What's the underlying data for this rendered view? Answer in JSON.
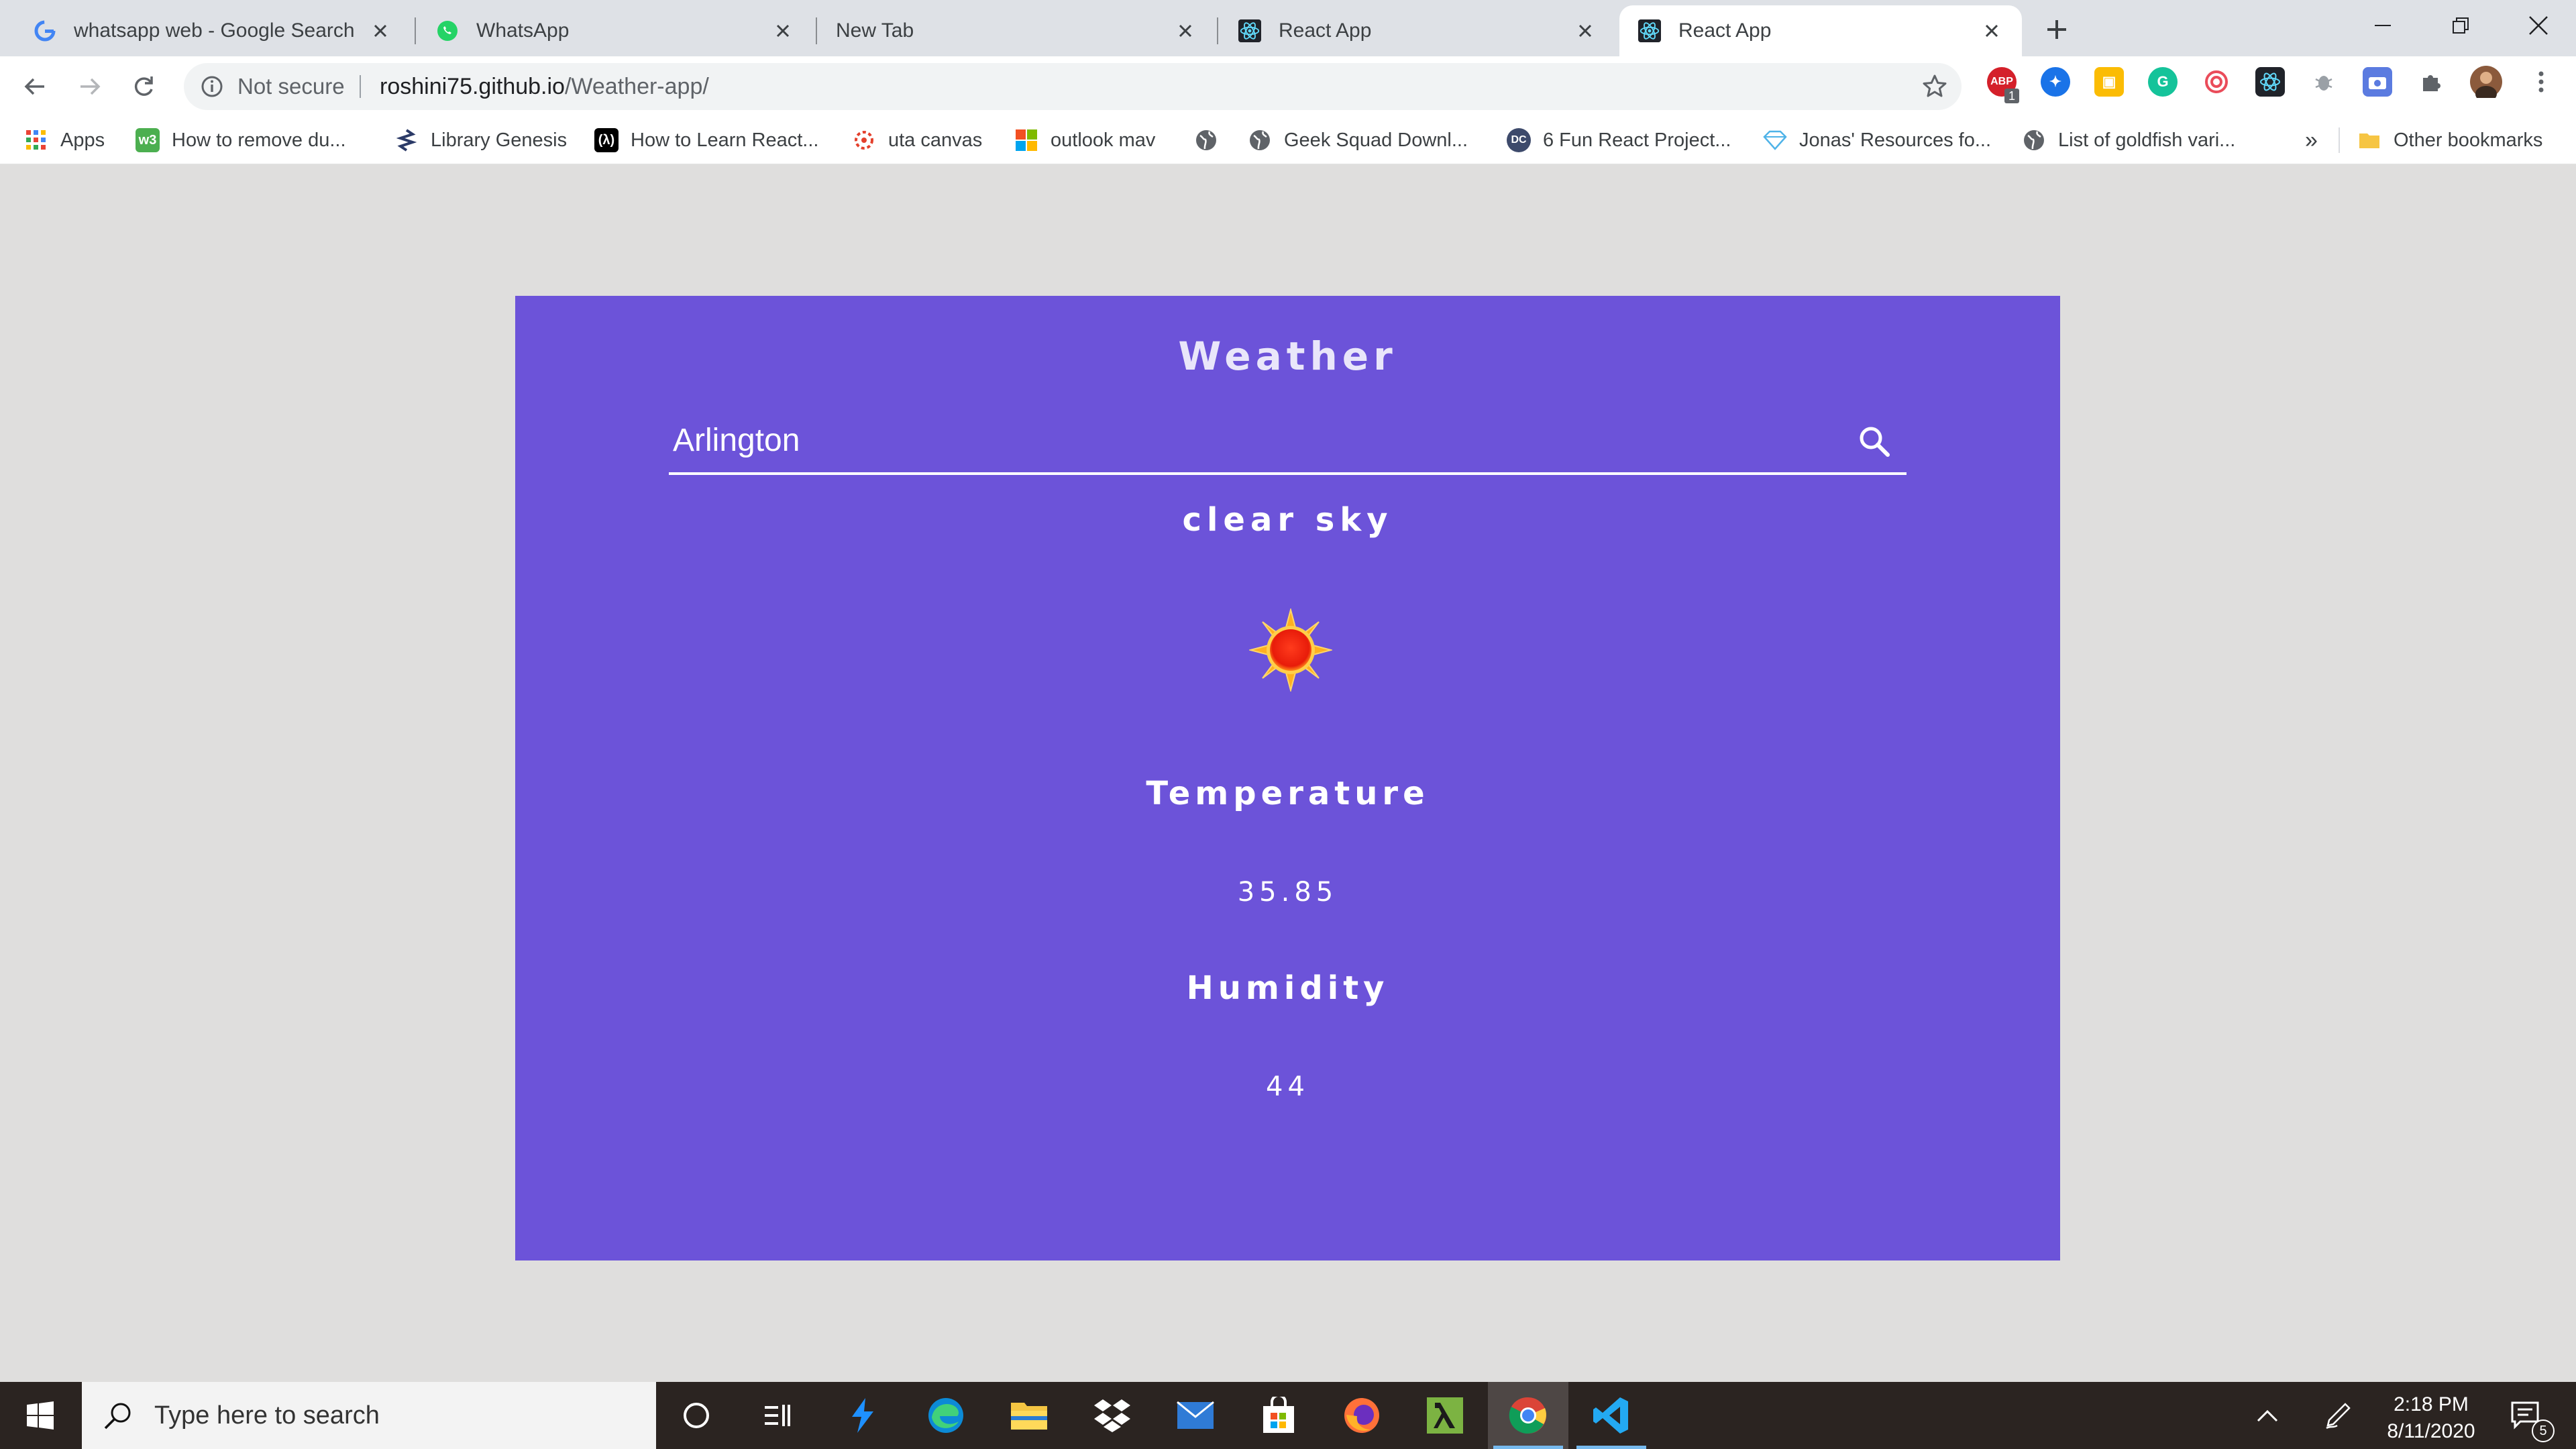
{
  "browser": {
    "tabs": [
      {
        "title": "whatsapp web - Google Search",
        "icon": "google-icon"
      },
      {
        "title": "WhatsApp",
        "icon": "whatsapp-icon"
      },
      {
        "title": "New Tab",
        "icon": "none"
      },
      {
        "title": "React App",
        "icon": "react-icon"
      },
      {
        "title": "React App",
        "icon": "react-icon",
        "active": true
      }
    ],
    "address": {
      "security_label": "Not secure",
      "url_host": "roshini75.github.io",
      "url_path": "/Weather-app/"
    },
    "extension_badge": "1",
    "bookmarks": [
      {
        "label": "Apps",
        "icon": "apps-grid-icon"
      },
      {
        "label": "How to remove du...",
        "icon": "w3-icon"
      },
      {
        "label": "Library Genesis",
        "icon": "libgen-icon"
      },
      {
        "label": "How to Learn React...",
        "icon": "dev-icon"
      },
      {
        "label": "uta canvas",
        "icon": "canvas-icon"
      },
      {
        "label": "outlook mav",
        "icon": "microsoft-icon"
      },
      {
        "label": "",
        "icon": "globe-icon"
      },
      {
        "label": "Geek Squad Downl...",
        "icon": "globe-icon"
      },
      {
        "label": "6 Fun React Project...",
        "icon": "dc-icon"
      },
      {
        "label": "Jonas' Resources fo...",
        "icon": "diamond-icon"
      },
      {
        "label": "List of goldfish vari...",
        "icon": "globe-icon"
      }
    ],
    "overflow_label": "»",
    "other_bookmarks": "Other bookmarks"
  },
  "weather": {
    "title": "Weather",
    "city_value": "Arlington",
    "description": "clear sky",
    "temperature_label": "Temperature",
    "temperature_value": "35.85",
    "humidity_label": "Humidity",
    "humidity_value": "44"
  },
  "taskbar": {
    "search_placeholder": "Type here to search",
    "time": "2:18 PM",
    "date": "8/11/2020",
    "notification_count": "5"
  },
  "colors": {
    "card_background": "#6c53d9",
    "page_background": "#dfdedd",
    "tabstrip": "#dee1e6",
    "taskbar": "#2b2421"
  }
}
